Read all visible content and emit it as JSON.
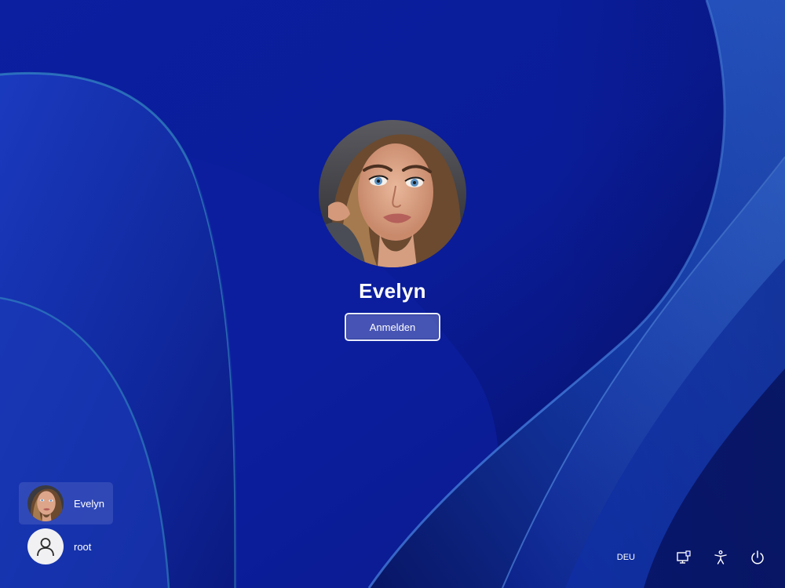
{
  "login": {
    "username": "Evelyn",
    "signin_label": "Anmelden"
  },
  "users": [
    {
      "name": "Evelyn",
      "selected": true,
      "avatar": "photo-avatar"
    },
    {
      "name": "root",
      "selected": false,
      "avatar": "generic-person-icon"
    }
  ],
  "tray": {
    "language": "DEU",
    "icons": [
      "network-icon",
      "accessibility-icon",
      "power-icon"
    ]
  },
  "colors": {
    "background": "#0a1a9a",
    "ribbon_light": "#2a5bd4",
    "ribbon_dark": "#0a1470",
    "text": "#ffffff"
  }
}
